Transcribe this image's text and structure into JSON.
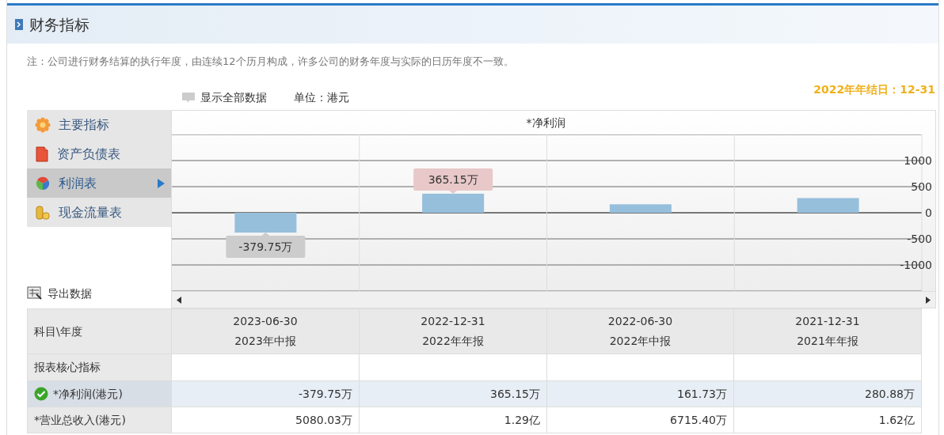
{
  "header": {
    "title": "财务指标"
  },
  "note": "注：公司进行财务结算的执行年度，由连续12个历月构成，许多公司的财务年度与实际的日历年度不一致。",
  "fiscal_year_end": "2022年年结日：12-31",
  "toolbar": {
    "show_all": "显示全部数据",
    "unit": "单位：港元"
  },
  "nav": [
    {
      "label": "主要指标",
      "kind": "flower",
      "selected": false
    },
    {
      "label": "资产负债表",
      "kind": "document",
      "selected": false
    },
    {
      "label": "利润表",
      "kind": "ball",
      "selected": true
    },
    {
      "label": "现金流量表",
      "kind": "coins",
      "selected": false
    }
  ],
  "export": "导出数据",
  "chart": {
    "chart_data": {
      "type": "bar",
      "title": "*净利润",
      "grid": true,
      "ylim": [
        -1500,
        1500
      ],
      "yticks": [
        -1000,
        -500,
        0,
        500,
        1000
      ],
      "series": [
        {
          "color": "#96bfdc",
          "values": [
            -379.75,
            365.15,
            161.73,
            280.88
          ]
        }
      ],
      "value_labels": [
        "-379.75万",
        "365.15万",
        null,
        null
      ]
    }
  },
  "table": {
    "corner": "科目\\年度",
    "columns": [
      {
        "date": "2023-06-30",
        "period": "2023年中报"
      },
      {
        "date": "2022-12-31",
        "period": "2022年年报"
      },
      {
        "date": "2022-06-30",
        "period": "2022年中报"
      },
      {
        "date": "2021-12-31",
        "period": "2021年年报"
      }
    ],
    "rows": [
      {
        "label": "报表核心指标",
        "kind": "section"
      },
      {
        "label": "*净利润(港元)",
        "kind": "data",
        "selected": true,
        "checked": true,
        "values": [
          "-379.75万",
          "365.15万",
          "161.73万",
          "280.88万"
        ]
      },
      {
        "label": "*营业总收入(港元)",
        "kind": "data",
        "selected": false,
        "checked": false,
        "values": [
          "5080.03万",
          "1.29亿",
          "6715.40万",
          "1.62亿"
        ]
      }
    ]
  }
}
